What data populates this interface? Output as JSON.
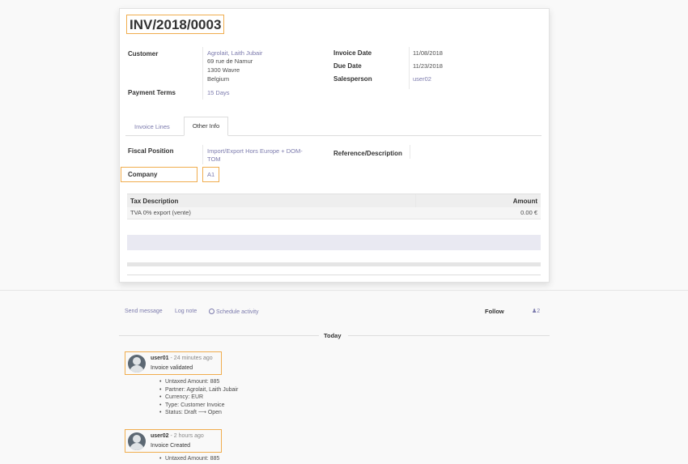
{
  "invoice": {
    "number": "INV/2018/0003",
    "customer_label": "Customer",
    "customer_name": "Agrolait, Laith Jubair",
    "address_line1": "69 rue de Namur",
    "address_line2": "1300 Wavre",
    "address_line3": "Belgium",
    "payment_terms_label": "Payment Terms",
    "payment_terms": "15 Days",
    "invoice_date_label": "Invoice Date",
    "invoice_date": "11/08/2018",
    "due_date_label": "Due Date",
    "due_date": "11/23/2018",
    "salesperson_label": "Salesperson",
    "salesperson": "user02"
  },
  "tabs": [
    {
      "label": "Invoice Lines",
      "active": false
    },
    {
      "label": "Other Info",
      "active": true
    }
  ],
  "other_info": {
    "fiscal_position_label": "Fiscal Position",
    "fiscal_position_line1": "Import/Export Hors Europe + DOM-",
    "fiscal_position_line2": "TOM",
    "reference_label": "Reference/Description",
    "company_label": "Company",
    "company": "A1"
  },
  "tax_table": {
    "headers": [
      "Tax Description",
      "Amount"
    ],
    "rows": [
      {
        "description": "TVA 0% export (vente)",
        "amount": "0.00 €"
      }
    ]
  },
  "chatter": {
    "send_message": "Send message",
    "log_note": "Log note",
    "schedule_activity": "Schedule activity",
    "follow": "Follow",
    "followers_count": "2",
    "date_separator": "Today",
    "messages": [
      {
        "author": "user01",
        "time": " - 24 minutes ago",
        "text": "Invoice validated",
        "tracking": [
          "Untaxed Amount: 885",
          "Partner: Agrolait, Laith Jubair",
          "Currency: EUR",
          "Type: Customer Invoice",
          "Status: Draft ⟶ Open"
        ]
      },
      {
        "author": "user02",
        "time": " - 2 hours ago",
        "text": "Invoice Created",
        "tracking": [
          "Untaxed Amount: 885"
        ]
      }
    ]
  },
  "colors": {
    "link": "#7c7bad",
    "highlight": "#f0ad4e",
    "avatar_bg": "#5c6873"
  }
}
